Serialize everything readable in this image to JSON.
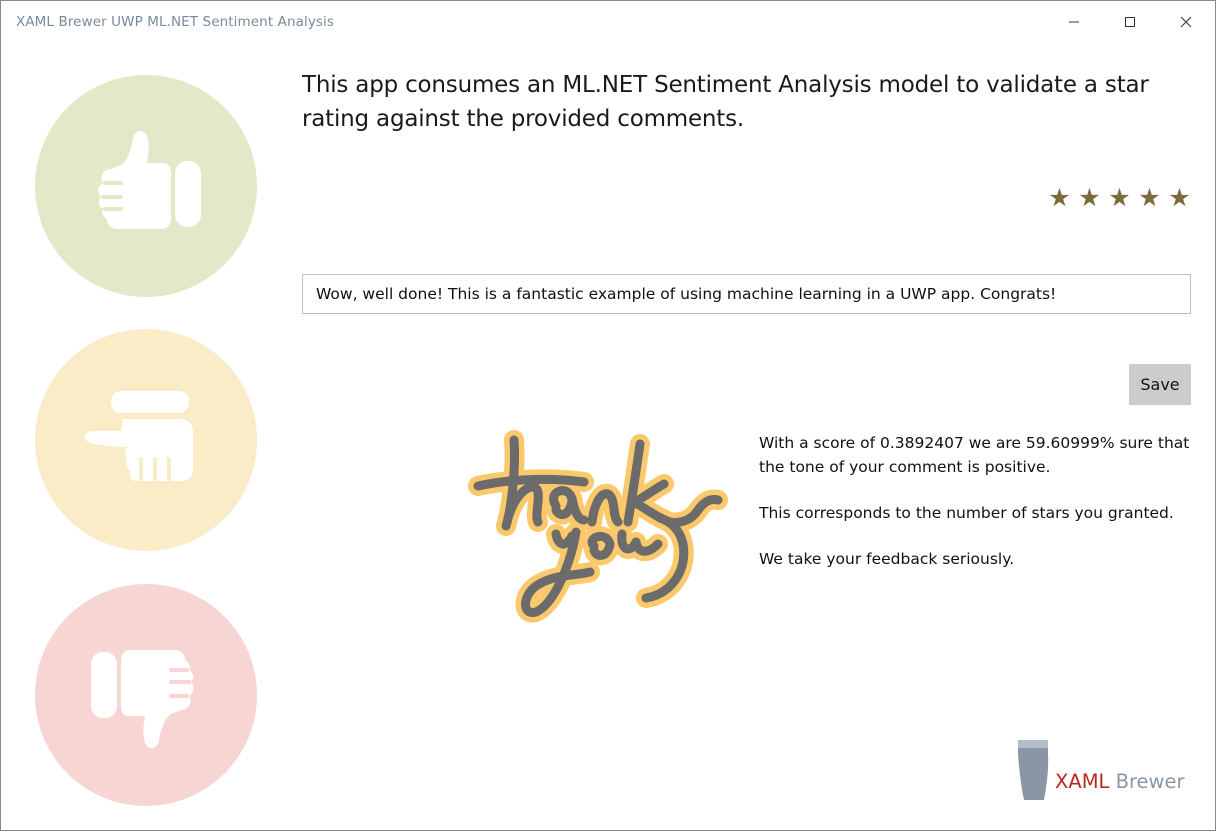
{
  "window": {
    "title": "XAML Brewer UWP ML.NET Sentiment Analysis"
  },
  "sidebar": {
    "circles": [
      {
        "icon": "thumbs-up-icon",
        "color": "#e3e9c8"
      },
      {
        "icon": "thumbs-sideways-icon",
        "color": "#fbecc8"
      },
      {
        "icon": "thumbs-down-icon",
        "color": "#f7d5d2"
      }
    ]
  },
  "main": {
    "intro": "This app consumes an ML.NET Sentiment Analysis model to validate a star rating against the provided comments.",
    "rating": {
      "value": 5,
      "max": 5,
      "color": "#7d6a3d"
    },
    "comment_value": "Wow, well done! This is a fantastic example of using machine learning in a UWP app. Congrats!",
    "save_label": "Save",
    "result": {
      "line1": "With a score of 0.3892407 we are 59.60999% sure that the tone of your comment is positive.",
      "line2": "This corresponds to the number of stars you granted.",
      "line3": "We take your feedback seriously."
    },
    "thank_you_image": "thank-you-lettering"
  },
  "brand": {
    "part1": "XAML",
    "part2": " Brewer",
    "accent": "#b52a22"
  }
}
